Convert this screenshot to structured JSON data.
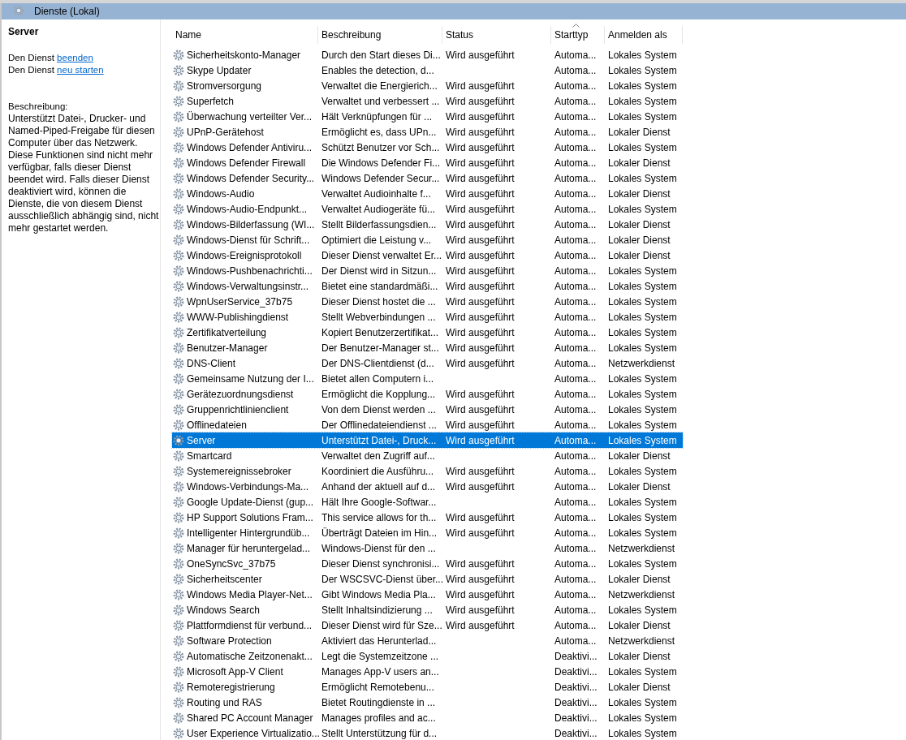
{
  "window": {
    "title": "Dienste (Lokal)"
  },
  "details": {
    "service_name": "Server",
    "actions": [
      {
        "text": "Den Dienst",
        "link": "beenden"
      },
      {
        "text": "Den Dienst",
        "link": "neu starten"
      }
    ],
    "description_label": "Beschreibung:",
    "description": "Unterstützt Datei-, Drucker- und Named-Piped-Freigabe für diesen Computer über das Netzwerk. Diese Funktionen sind nicht mehr verfügbar, falls dieser Dienst beendet wird. Falls dieser Dienst deaktiviert wird, können die Dienste, die von diesem Dienst ausschließlich abhängig sind, nicht mehr gestartet werden."
  },
  "table": {
    "columns": [
      {
        "label": "Name",
        "sorted": false
      },
      {
        "label": "Beschreibung",
        "sorted": false
      },
      {
        "label": "Status",
        "sorted": false
      },
      {
        "label": "Starttyp",
        "sorted": true
      },
      {
        "label": "Anmelden als",
        "sorted": false
      }
    ],
    "rows": [
      {
        "name": "Sicherheitskonto-Manager",
        "description": "Durch den Start dieses Di...",
        "status": "Wird ausgeführt",
        "startup": "Automa...",
        "logon": "Lokales System",
        "selected": false
      },
      {
        "name": "Skype Updater",
        "description": "Enables the detection, d...",
        "startup": "Automa...",
        "logon": "Lokales System",
        "selected": false
      },
      {
        "name": "Stromversorgung",
        "description": "Verwaltet die Energierich...",
        "status": "Wird ausgeführt",
        "startup": "Automa...",
        "logon": "Lokales System",
        "selected": false
      },
      {
        "name": "Superfetch",
        "description": "Verwaltet und verbessert ...",
        "status": "Wird ausgeführt",
        "startup": "Automa...",
        "logon": "Lokales System",
        "selected": false
      },
      {
        "name": "Überwachung verteilter Ver...",
        "description": "Hält Verknüpfungen für ...",
        "status": "Wird ausgeführt",
        "startup": "Automa...",
        "logon": "Lokales System",
        "selected": false
      },
      {
        "name": "UPnP-Gerätehost",
        "description": "Ermöglicht es, dass UPn...",
        "status": "Wird ausgeführt",
        "startup": "Automa...",
        "logon": "Lokaler Dienst",
        "selected": false
      },
      {
        "name": "Windows Defender Antiviru...",
        "description": "Schützt Benutzer vor Sch...",
        "status": "Wird ausgeführt",
        "startup": "Automa...",
        "logon": "Lokales System",
        "selected": false
      },
      {
        "name": "Windows Defender Firewall",
        "description": "Die Windows Defender Fi...",
        "status": "Wird ausgeführt",
        "startup": "Automa...",
        "logon": "Lokaler Dienst",
        "selected": false
      },
      {
        "name": "Windows Defender Security...",
        "description": "Windows Defender Secur...",
        "status": "Wird ausgeführt",
        "startup": "Automa...",
        "logon": "Lokales System",
        "selected": false
      },
      {
        "name": "Windows-Audio",
        "description": "Verwaltet Audioinhalte f...",
        "status": "Wird ausgeführt",
        "startup": "Automa...",
        "logon": "Lokaler Dienst",
        "selected": false
      },
      {
        "name": "Windows-Audio-Endpunkt...",
        "description": "Verwaltet Audiogeräte fü...",
        "status": "Wird ausgeführt",
        "startup": "Automa...",
        "logon": "Lokales System",
        "selected": false
      },
      {
        "name": "Windows-Bilderfassung (WI...",
        "description": "Stellt Bilderfassungsdien...",
        "status": "Wird ausgeführt",
        "startup": "Automa...",
        "logon": "Lokaler Dienst",
        "selected": false
      },
      {
        "name": "Windows-Dienst für Schrift...",
        "description": "Optimiert die Leistung v...",
        "status": "Wird ausgeführt",
        "startup": "Automa...",
        "logon": "Lokaler Dienst",
        "selected": false
      },
      {
        "name": "Windows-Ereignisprotokoll",
        "description": "Dieser Dienst verwaltet Er...",
        "status": "Wird ausgeführt",
        "startup": "Automa...",
        "logon": "Lokaler Dienst",
        "selected": false
      },
      {
        "name": "Windows-Pushbenachrichti...",
        "description": "Der Dienst wird in Sitzun...",
        "status": "Wird ausgeführt",
        "startup": "Automa...",
        "logon": "Lokales System",
        "selected": false
      },
      {
        "name": "Windows-Verwaltungsinstr...",
        "description": "Bietet eine standardmäßi...",
        "status": "Wird ausgeführt",
        "startup": "Automa...",
        "logon": "Lokales System",
        "selected": false
      },
      {
        "name": "WpnUserService_37b75",
        "description": "Dieser Dienst hostet die ...",
        "status": "Wird ausgeführt",
        "startup": "Automa...",
        "logon": "Lokales System",
        "selected": false
      },
      {
        "name": "WWW-Publishingdienst",
        "description": "Stellt Webverbindungen ...",
        "status": "Wird ausgeführt",
        "startup": "Automa...",
        "logon": "Lokales System",
        "selected": false
      },
      {
        "name": "Zertifikatverteilung",
        "description": "Kopiert Benutzerzertifikat...",
        "status": "Wird ausgeführt",
        "startup": "Automa...",
        "logon": "Lokales System",
        "selected": false
      },
      {
        "name": "Benutzer-Manager",
        "description": "Der Benutzer-Manager st...",
        "status": "Wird ausgeführt",
        "startup": "Automa...",
        "logon": "Lokales System",
        "selected": false
      },
      {
        "name": "DNS-Client",
        "description": "Der DNS-Clientdienst (d...",
        "status": "Wird ausgeführt",
        "startup": "Automa...",
        "logon": "Netzwerkdienst",
        "selected": false
      },
      {
        "name": "Gemeinsame Nutzung der I...",
        "description": "Bietet allen Computern i...",
        "startup": "Automa...",
        "logon": "Lokales System",
        "selected": false
      },
      {
        "name": "Gerätezuordnungsdienst",
        "description": "Ermöglicht die Kopplung...",
        "status": "Wird ausgeführt",
        "startup": "Automa...",
        "logon": "Lokales System",
        "selected": false
      },
      {
        "name": "Gruppenrichtlinienclient",
        "description": "Von dem Dienst werden ...",
        "status": "Wird ausgeführt",
        "startup": "Automa...",
        "logon": "Lokales System",
        "selected": false
      },
      {
        "name": "Offlinedateien",
        "description": "Der Offlinedateiendienst ...",
        "status": "Wird ausgeführt",
        "startup": "Automa...",
        "logon": "Lokales System",
        "selected": false
      },
      {
        "name": "Server",
        "description": "Unterstützt Datei-, Druck...",
        "status": "Wird ausgeführt",
        "startup": "Automa...",
        "logon": "Lokales System",
        "selected": true
      },
      {
        "name": "Smartcard",
        "description": "Verwaltet den Zugriff auf...",
        "startup": "Automa...",
        "logon": "Lokaler Dienst",
        "selected": false
      },
      {
        "name": "Systemereignissebroker",
        "description": "Koordiniert die Ausführu...",
        "status": "Wird ausgeführt",
        "startup": "Automa...",
        "logon": "Lokales System",
        "selected": false
      },
      {
        "name": "Windows-Verbindungs-Ma...",
        "description": "Anhand der aktuell auf d...",
        "status": "Wird ausgeführt",
        "startup": "Automa...",
        "logon": "Lokaler Dienst",
        "selected": false
      },
      {
        "name": "Google Update-Dienst (gup...",
        "description": "Hält Ihre Google-Softwar...",
        "startup": "Automa...",
        "logon": "Lokales System",
        "selected": false
      },
      {
        "name": "HP Support Solutions Fram...",
        "description": "This service allows for th...",
        "status": "Wird ausgeführt",
        "startup": "Automa...",
        "logon": "Lokales System",
        "selected": false
      },
      {
        "name": "Intelligenter Hintergrundüb...",
        "description": "Überträgt Dateien im Hin...",
        "status": "Wird ausgeführt",
        "startup": "Automa...",
        "logon": "Lokales System",
        "selected": false
      },
      {
        "name": "Manager für heruntergelad...",
        "description": "Windows-Dienst für den ...",
        "startup": "Automa...",
        "logon": "Netzwerkdienst",
        "selected": false
      },
      {
        "name": "OneSyncSvc_37b75",
        "description": "Dieser Dienst synchronisi...",
        "status": "Wird ausgeführt",
        "startup": "Automa...",
        "logon": "Lokales System",
        "selected": false
      },
      {
        "name": "Sicherheitscenter",
        "description": "Der WSCSVC-Dienst über...",
        "status": "Wird ausgeführt",
        "startup": "Automa...",
        "logon": "Lokaler Dienst",
        "selected": false
      },
      {
        "name": "Windows Media Player-Net...",
        "description": "Gibt Windows Media Pla...",
        "status": "Wird ausgeführt",
        "startup": "Automa...",
        "logon": "Netzwerkdienst",
        "selected": false
      },
      {
        "name": "Windows Search",
        "description": "Stellt Inhaltsindizierung ...",
        "status": "Wird ausgeführt",
        "startup": "Automa...",
        "logon": "Lokales System",
        "selected": false
      },
      {
        "name": "Plattformdienst für verbund...",
        "description": "Dieser Dienst wird für Sze...",
        "status": "Wird ausgeführt",
        "startup": "Automa...",
        "logon": "Lokaler Dienst",
        "selected": false
      },
      {
        "name": "Software Protection",
        "description": "Aktiviert das Herunterlad...",
        "startup": "Automa...",
        "logon": "Netzwerkdienst",
        "selected": false
      },
      {
        "name": "Automatische Zeitzonenakt...",
        "description": "Legt die Systemzeitzone ...",
        "startup": "Deaktivi...",
        "logon": "Lokaler Dienst",
        "selected": false
      },
      {
        "name": "Microsoft App-V Client",
        "description": "Manages App-V users an...",
        "startup": "Deaktivi...",
        "logon": "Lokales System",
        "selected": false
      },
      {
        "name": "Remoteregistrierung",
        "description": "Ermöglicht Remotebenu...",
        "startup": "Deaktivi...",
        "logon": "Lokaler Dienst",
        "selected": false
      },
      {
        "name": "Routing und RAS",
        "description": "Bietet Routingdienste in ...",
        "startup": "Deaktivi...",
        "logon": "Lokales System",
        "selected": false
      },
      {
        "name": "Shared PC Account Manager",
        "description": "Manages profiles and ac...",
        "startup": "Deaktivi...",
        "logon": "Lokales System",
        "selected": false
      },
      {
        "name": "User Experience Virtualizatio...",
        "description": "Stellt Unterstützung für d...",
        "startup": "Deaktivi...",
        "logon": "Lokales System",
        "selected": false
      }
    ]
  }
}
